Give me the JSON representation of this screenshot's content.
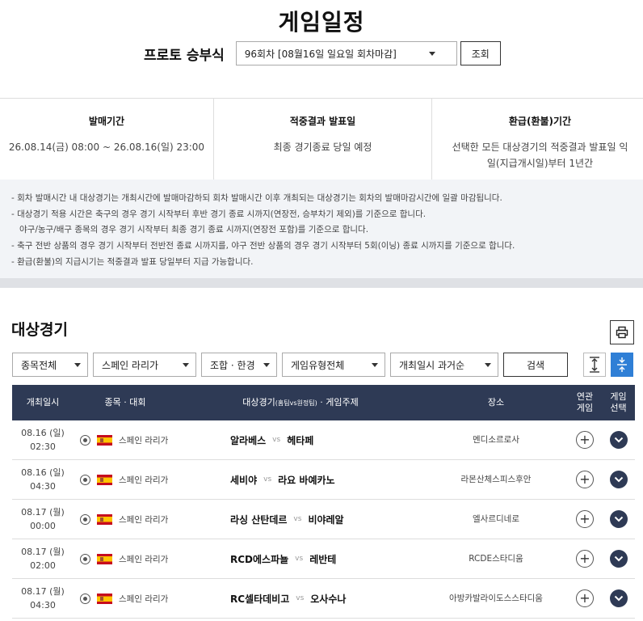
{
  "page_title": "게임일정",
  "selector": {
    "label": "프로토 승부식",
    "round_value": "96회차 [08월16일 일요일 회차마감]",
    "search_button": "조회"
  },
  "period": [
    {
      "title": "발매기간",
      "text": "26.08.14(금) 08:00 ~ 26.08.16(일) 23:00"
    },
    {
      "title": "적중결과 발표일",
      "text": "최종 경기종료 당일 예정"
    },
    {
      "title": "환급(환불)기간",
      "text": "선택한 모든 대상경기의 적중결과 발표일 익일(지급개시일)부터 1년간"
    }
  ],
  "notices": [
    "- 회차 발매시간 내 대상경기는 개최시간에 발매마감하되 회차 발매시간 이후 개최되는 대상경기는 회차의 발매마감시간에 일괄 마감됩니다.",
    "- 대상경기 적용 시간은 축구의 경우 경기 시작부터 후반 경기 종료 시까지(연장전, 승부차기 제외)를 기준으로 합니다.",
    "야구/농구/배구 종목의 경우 경기 시작부터 최종 경기 종료 시까지(연장전 포함)를 기준으로 합니다.",
    "- 축구 전반 상품의 경우 경기 시작부터 전반전 종료 시까지를, 야구 전반 상품의 경우 경기 시작부터 5회(이닝) 종료 시까지를 기준으로 합니다.",
    "- 환급(환불)의 지급시기는 적중결과 발표 당일부터 지급 가능합니다."
  ],
  "games_section": {
    "title": "대상경기",
    "filters": {
      "sport": "종목전체",
      "league": "스페인 라리가",
      "combo": "조합 · 한경",
      "game_type": "게임유형전체",
      "sort": "개최일시 과거순",
      "search_button": "검색"
    },
    "columns": {
      "date": "개최일시",
      "league": "종목 · 대회",
      "match": "대상경기",
      "match_sub": "(홈팀vs원정팀)",
      "match_tail": " · 게임주제",
      "venue": "장소",
      "related": "연관 게임",
      "select": "게임 선택"
    },
    "vs_label": "vs",
    "plus_symbol": "+",
    "rows": [
      {
        "date": "08.16 (일)",
        "time": "02:30",
        "league": "스페인 라리가",
        "home": "알라베스",
        "away": "헤타페",
        "venue": "멘디소르로사"
      },
      {
        "date": "08.16 (일)",
        "time": "04:30",
        "league": "스페인 라리가",
        "home": "세비야",
        "away": "라요 바예카노",
        "venue": "라몬산체스피스후안"
      },
      {
        "date": "08.17 (월)",
        "time": "00:00",
        "league": "스페인 라리가",
        "home": "라싱 산탄데르",
        "away": "비야레알",
        "venue": "엘사르디네로"
      },
      {
        "date": "08.17 (월)",
        "time": "02:00",
        "league": "스페인 라리가",
        "home": "RCD에스파뇰",
        "away": "레반테",
        "venue": "RCDE스타디움"
      },
      {
        "date": "08.17 (월)",
        "time": "04:30",
        "league": "스페인 라리가",
        "home": "RC셀타데비고",
        "away": "오사수나",
        "venue": "아방카발라이도스스타디움"
      }
    ]
  },
  "colors": {
    "header_bg": "#2e3a55",
    "active_view": "#2f7fd6",
    "notice_bg": "#f2f4f7"
  }
}
